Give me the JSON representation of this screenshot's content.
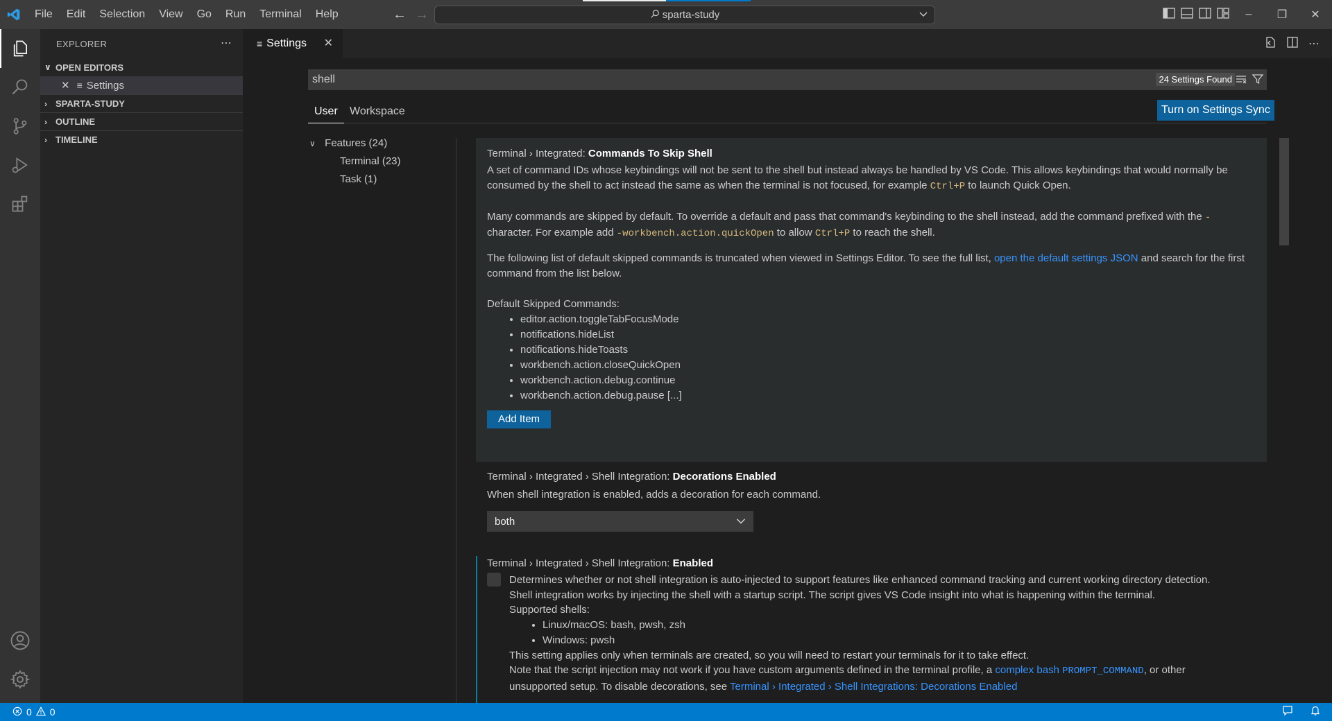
{
  "menu": [
    "File",
    "Edit",
    "Selection",
    "View",
    "Go",
    "Run",
    "Terminal",
    "Help"
  ],
  "command_center": {
    "text": "sparta-study"
  },
  "sidebar": {
    "title": "EXPLORER",
    "open_editors_label": "OPEN EDITORS",
    "open_editor_item": "Settings",
    "sections": [
      "SPARTA-STUDY",
      "OUTLINE",
      "TIMELINE"
    ]
  },
  "tab": {
    "label": "Settings"
  },
  "settings": {
    "search_value": "shell",
    "found_label": "24 Settings Found",
    "scope_tabs": [
      "User",
      "Workspace"
    ],
    "sync_button": "Turn on Settings Sync",
    "toc": {
      "features": "Features (24)",
      "terminal": "Terminal (23)",
      "task": "Task (1)"
    },
    "skip_shell": {
      "breadcrumb": "Terminal › Integrated: ",
      "name": "Commands To Skip Shell",
      "p1_a": "A set of command IDs whose keybindings will not be sent to the shell but instead always be handled by VS Code. This allows keybindings that would normally be consumed by the shell to act instead the same as when the terminal is not focused, for example ",
      "p1_code": "Ctrl+P",
      "p1_b": " to launch Quick Open.",
      "p2_a": "Many commands are skipped by default. To override a default and pass that command's keybinding to the shell instead, add the command prefixed with the ",
      "p2_code1": "-",
      "p2_b": " character. For example add ",
      "p2_code2": "-workbench.action.quickOpen",
      "p2_c": " to allow ",
      "p2_code3": "Ctrl+P",
      "p2_d": " to reach the shell.",
      "p3_a": "The following list of default skipped commands is truncated when viewed in Settings Editor. To see the full list, ",
      "p3_link": "open the default settings JSON",
      "p3_b": " and search for the first command from the list below.",
      "list_label": "Default Skipped Commands:",
      "commands": [
        "editor.action.toggleTabFocusMode",
        "notifications.hideList",
        "notifications.hideToasts",
        "workbench.action.closeQuickOpen",
        "workbench.action.debug.continue",
        "workbench.action.debug.pause [...]"
      ],
      "add_item": "Add Item"
    },
    "decorations": {
      "breadcrumb": "Terminal › Integrated › Shell Integration: ",
      "name": "Decorations Enabled",
      "desc": "When shell integration is enabled, adds a decoration for each command.",
      "value": "both"
    },
    "integration": {
      "breadcrumb": "Terminal › Integrated › Shell Integration: ",
      "name": "Enabled",
      "d1": "Determines whether or not shell integration is auto-injected to support features like enhanced command tracking and current working directory detection.",
      "d2": "Shell integration works by injecting the shell with a startup script. The script gives VS Code insight into what is happening within the terminal.",
      "d3": "Supported shells:",
      "shells": [
        "Linux/macOS: bash, pwsh, zsh",
        "Windows: pwsh"
      ],
      "d4": "This setting applies only when terminals are created, so you will need to restart your terminals for it to take effect.",
      "d5_a": "Note that the script injection may not work if you have custom arguments defined in the terminal profile, a ",
      "d5_link": "complex bash ",
      "d5_code": "PROMPT_COMMAND",
      "d5_b": ", or other",
      "d6_a": "unsupported setup. To disable decorations, see ",
      "d6_link": "Terminal › Integrated › Shell Integrations: Decorations Enabled"
    }
  },
  "status": {
    "errors": "0",
    "warnings": "0"
  },
  "colors": {
    "accent": "#007acc",
    "link": "#3794ff",
    "button": "#0e639c"
  }
}
